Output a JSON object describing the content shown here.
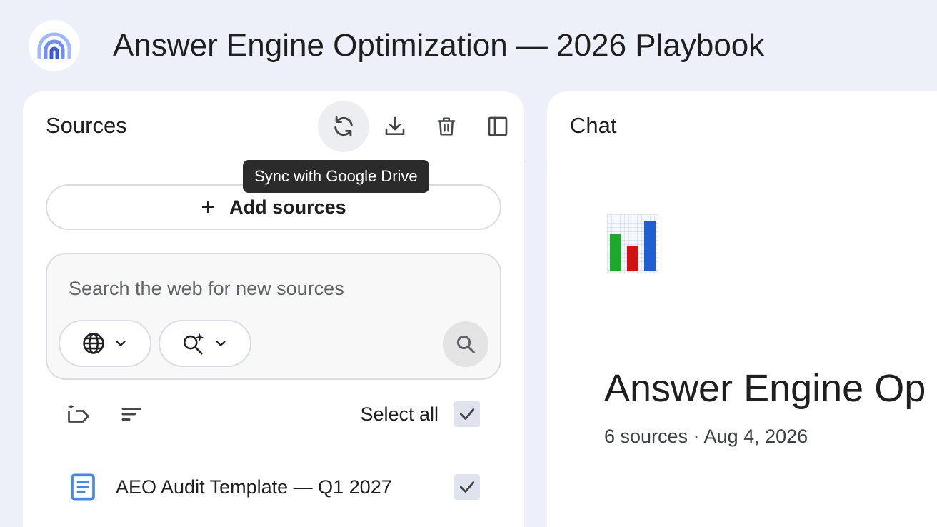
{
  "app": {
    "title": "Answer Engine Optimization — 2026 Playbook"
  },
  "sources_panel": {
    "title": "Sources",
    "header_buttons": [
      "sync-icon",
      "download-icon",
      "delete-icon",
      "collapse-panel-icon"
    ],
    "tooltip": "Sync with Google Drive",
    "add_sources_label": "Add sources",
    "search": {
      "placeholder": "Search the web for new sources",
      "source_chip_icon": "globe-icon",
      "mode_chip_icon": "magic-search-icon"
    },
    "select_all_label": "Select all",
    "select_all_checked": true,
    "items": [
      {
        "title": "AEO Audit Template — Q1 2027",
        "icon": "document-icon",
        "checked": true
      }
    ]
  },
  "chat_panel": {
    "title": "Chat",
    "notebook": {
      "emoji": "bar-chart-emoji",
      "title": "Answer Engine Op",
      "meta": "6 sources · Aug 4, 2026"
    }
  },
  "colors": {
    "background": "#edeff9",
    "panel": "#ffffff",
    "accent_blue": "#4285f4",
    "tooltip_bg": "#2b2b2b"
  }
}
